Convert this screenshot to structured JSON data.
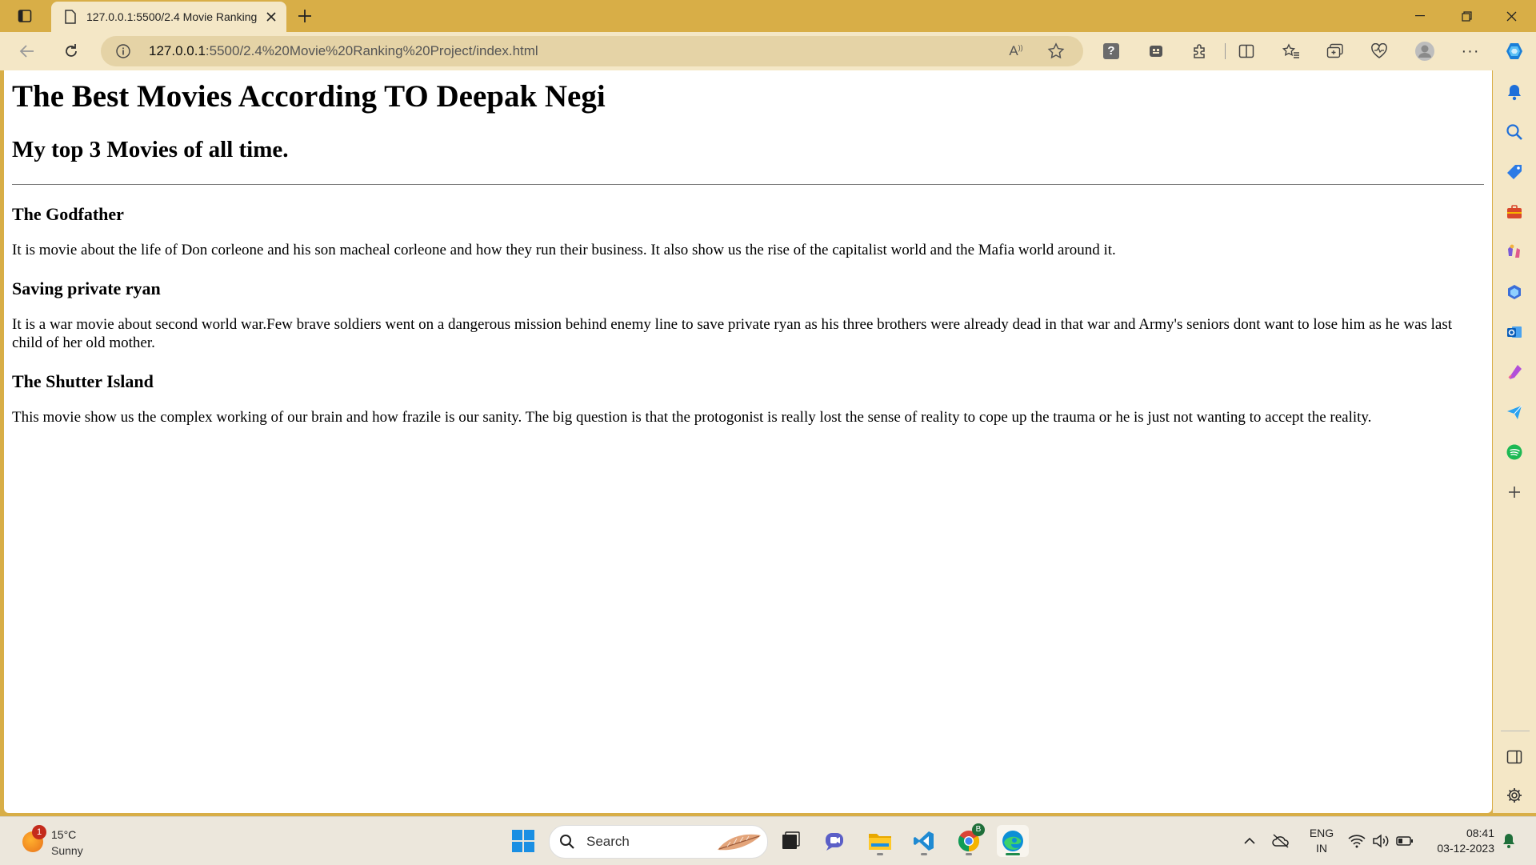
{
  "browser": {
    "tab_title": "127.0.0.1:5500/2.4 Movie Ranking",
    "url_host": "127.0.0.1",
    "url_rest": ":5500/2.4%20Movie%20Ranking%20Project/index.html",
    "accent_color": "#d8ae47"
  },
  "page": {
    "heading": "The Best Movies According TO Deepak Negi",
    "subheading": "My top 3 Movies of all time.",
    "movies": [
      {
        "title": "The Godfather",
        "description": "It is movie about the life of Don corleone and his son macheal corleone and how they run their business. It also show us the rise of the capitalist world and the Mafia world around it."
      },
      {
        "title": "Saving private ryan",
        "description": "It is a war movie about second world war.Few brave soldiers went on a dangerous mission behind enemy line to save private ryan as his three brothers were already dead in that war and Army's seniors dont want to lose him as he was last child of her old mother."
      },
      {
        "title": "The Shutter Island",
        "description": "This movie show us the complex working of our brain and how frazile is our sanity. The big question is that the protogonist is really lost the sense of reality to cope up the trauma or he is just not wanting to accept the reality."
      }
    ]
  },
  "taskbar": {
    "weather_badge": "1",
    "weather_temp": "15°C",
    "weather_condition": "Sunny",
    "search_label": "Search",
    "chrome_badge": "B",
    "language": "ENG",
    "region": "IN",
    "time": "08:41",
    "date": "03-12-2023"
  }
}
